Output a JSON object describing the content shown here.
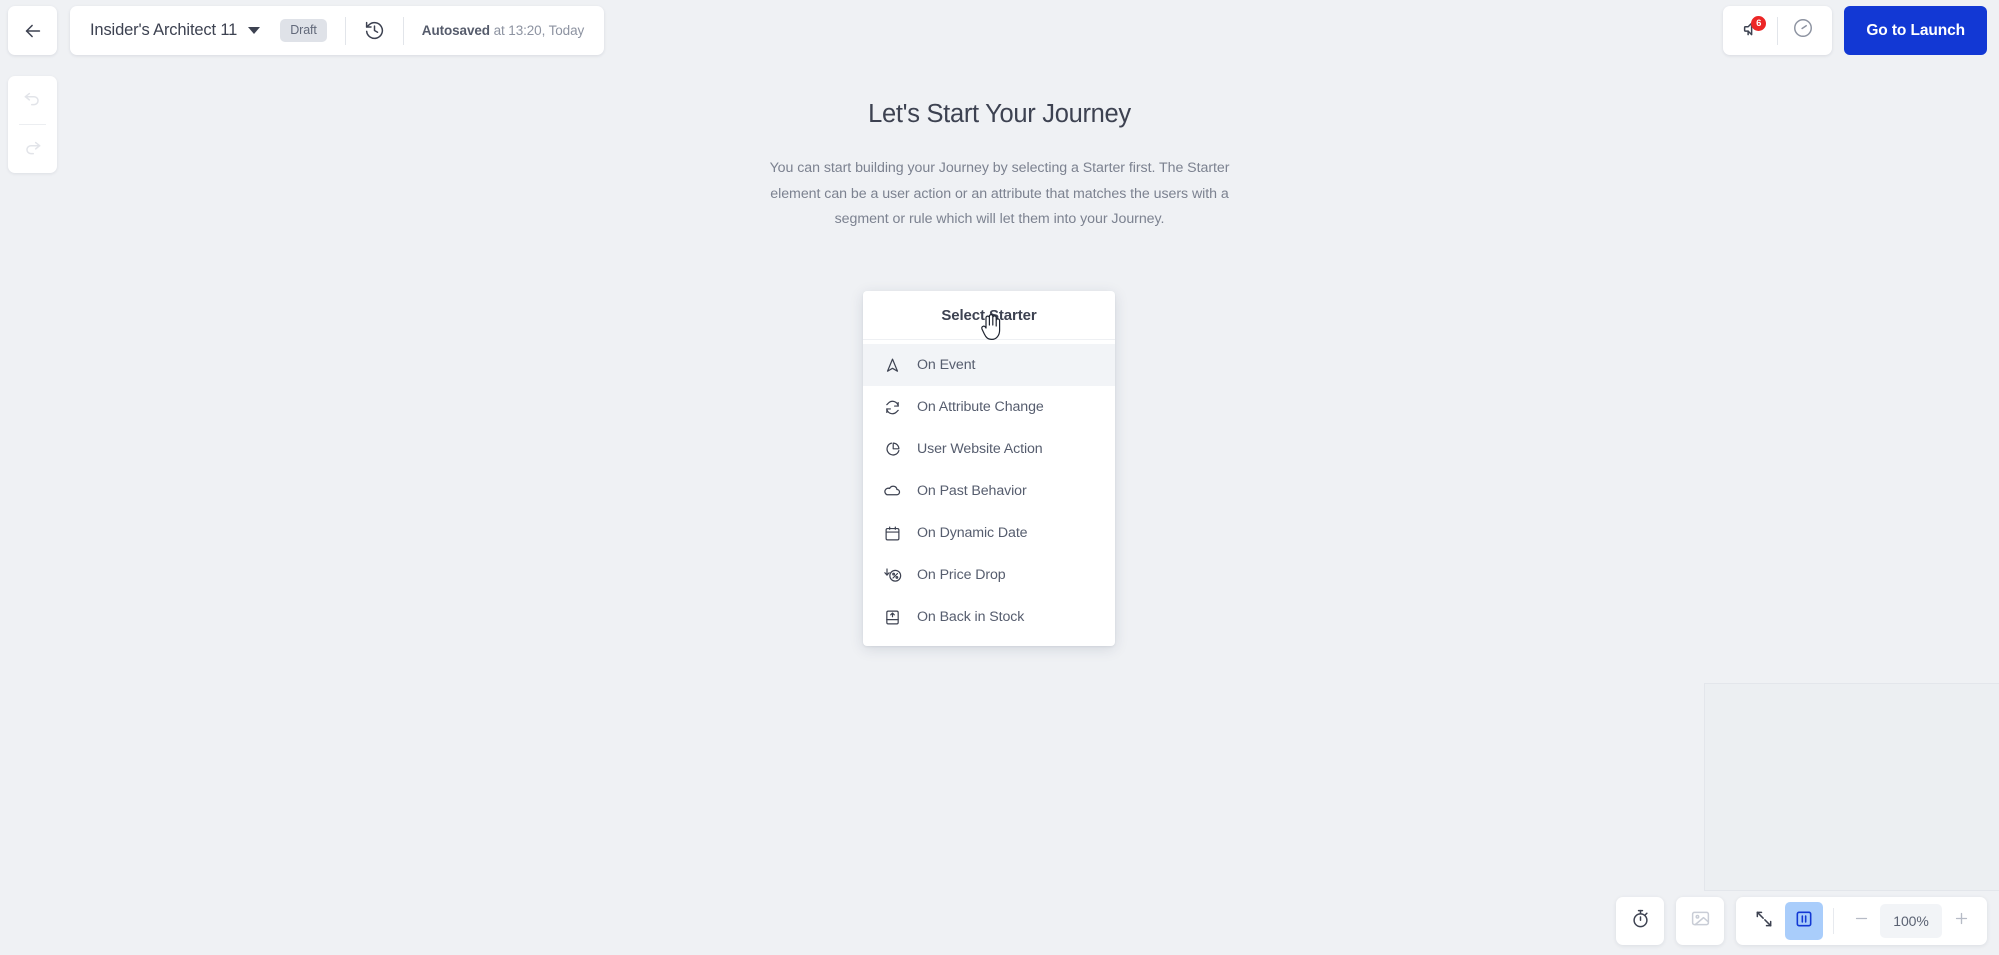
{
  "topbar": {
    "back_icon": "arrow-left-icon",
    "journey_name": "Insider's Architect 11",
    "status_badge": "Draft",
    "history_icon": "history-clock-icon",
    "autosave_label": "Autosaved",
    "autosave_detail": " at 13:20, Today",
    "announcement_icon": "megaphone-icon",
    "notification_count": "6",
    "speed_icon": "speedometer-icon",
    "launch_button": "Go to Launch",
    "accent_color": "#1238d4",
    "badge_color": "#ec2626"
  },
  "edit_tools": {
    "undo_icon": "undo-icon",
    "redo_icon": "redo-icon"
  },
  "main": {
    "title": "Let's Start Your Journey",
    "description": "You can start building your Journey by selecting a Starter first. The Starter element can be a user action or an attribute that matches the users with a segment or rule which will let them into your Journey."
  },
  "starter_dropdown": {
    "header": "Select Starter",
    "items": [
      {
        "label": "On Event",
        "icon": "navigation-arrow-icon",
        "active": true
      },
      {
        "label": "On Attribute Change",
        "icon": "refresh-sync-icon",
        "active": false
      },
      {
        "label": "User Website Action",
        "icon": "pie-chart-icon",
        "active": false
      },
      {
        "label": "On Past Behavior",
        "icon": "cloud-icon",
        "active": false
      },
      {
        "label": "On Dynamic Date",
        "icon": "calendar-icon",
        "active": false
      },
      {
        "label": "On Price Drop",
        "icon": "price-drop-icon",
        "active": false
      },
      {
        "label": "On Back in Stock",
        "icon": "back-in-stock-icon",
        "active": false
      }
    ]
  },
  "bottom_toolbar": {
    "timer_icon": "stopwatch-icon",
    "image_icon": "image-icon",
    "fit_icon": "fit-to-screen-icon",
    "layout_icon": "layout-columns-icon",
    "zoom_out": "minus-icon",
    "zoom_level": "100%",
    "zoom_in": "plus-icon",
    "active_color": "#a9cdfb"
  },
  "minimap": {
    "label": "canvas-minimap"
  }
}
